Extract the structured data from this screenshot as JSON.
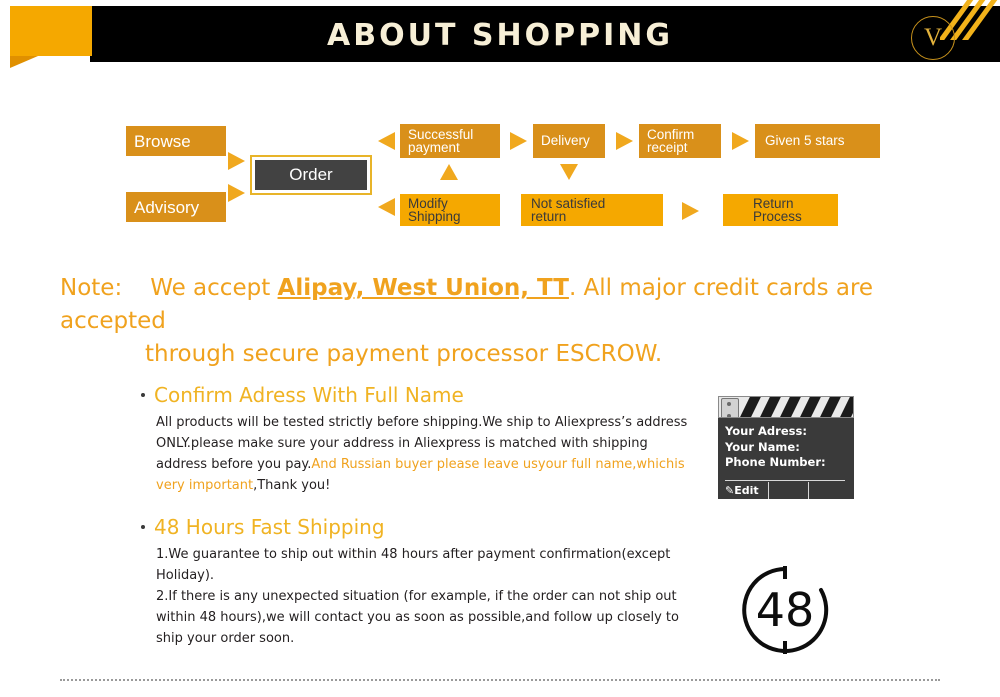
{
  "header": {
    "title": "ABOUT SHOPPING",
    "logo_letter": "V",
    "colors": {
      "bar": "#000000",
      "tab": "#F5A800",
      "title": "#F7EFD6",
      "accent": "#F2B21A"
    }
  },
  "flow": {
    "start_nodes": [
      {
        "label": "Browse"
      },
      {
        "label": "Advisory"
      }
    ],
    "center_node": {
      "label": "Order"
    },
    "top_row": [
      {
        "label": "Successful payment",
        "line1": "Successful",
        "line2": "payment"
      },
      {
        "label": "Delivery",
        "line1": "Delivery",
        "line2": ""
      },
      {
        "label": "Confirm receipt",
        "line1": "Confirm",
        "line2": "receipt"
      },
      {
        "label": "Given 5 stars",
        "line1": "Given 5 stars",
        "line2": ""
      }
    ],
    "bottom_row": [
      {
        "label": "Modify Shipping",
        "line1": "Modify",
        "line2": "Shipping"
      },
      {
        "label": "Not satisfied return",
        "line1": "Not satisfied",
        "line2": "return"
      },
      {
        "label": "Return Process",
        "line1": "Return",
        "line2": "Process"
      }
    ],
    "colors": {
      "dark_box": "#D9901A",
      "light_box": "#F5A800",
      "arrow": "#F0A81E",
      "order_bg": "#424242",
      "order_border": "#E8B429"
    }
  },
  "note": {
    "prefix": "Note:",
    "lead": "We accept ",
    "methods": "Alipay, West Union, TT",
    "rest": ". All major credit cards are accepted",
    "line2": "through secure payment processor ESCROW.",
    "color": "#F0A21E"
  },
  "sections": [
    {
      "heading": "Confirm Adress With Full Name",
      "body_before": "All products will be tested strictly before shipping.We ship to Aliexpress’s address ONLY.please make sure your address in Aliexpress is matched with shipping address before you pay.",
      "body_highlight": "And Russian buyer please leave usyour full name,whichis very important",
      "body_after": ",Thank you!"
    },
    {
      "heading": "48 Hours Fast Shipping",
      "body_line1": "1.We guarantee to ship out within 48 hours after payment confirmation(except Holiday).",
      "body_line2": "2.If there is any unexpected situation (for example, if the order can not ship out within 48 hours),we will contact you as soon as possible,and follow up closely to ship your order soon."
    }
  ],
  "clapperboard": {
    "field_address": "Your Adress:",
    "field_name": "Your Name:",
    "field_phone": "Phone Number:",
    "edit_label": "Edit"
  },
  "clock_badge": {
    "value": "48"
  }
}
